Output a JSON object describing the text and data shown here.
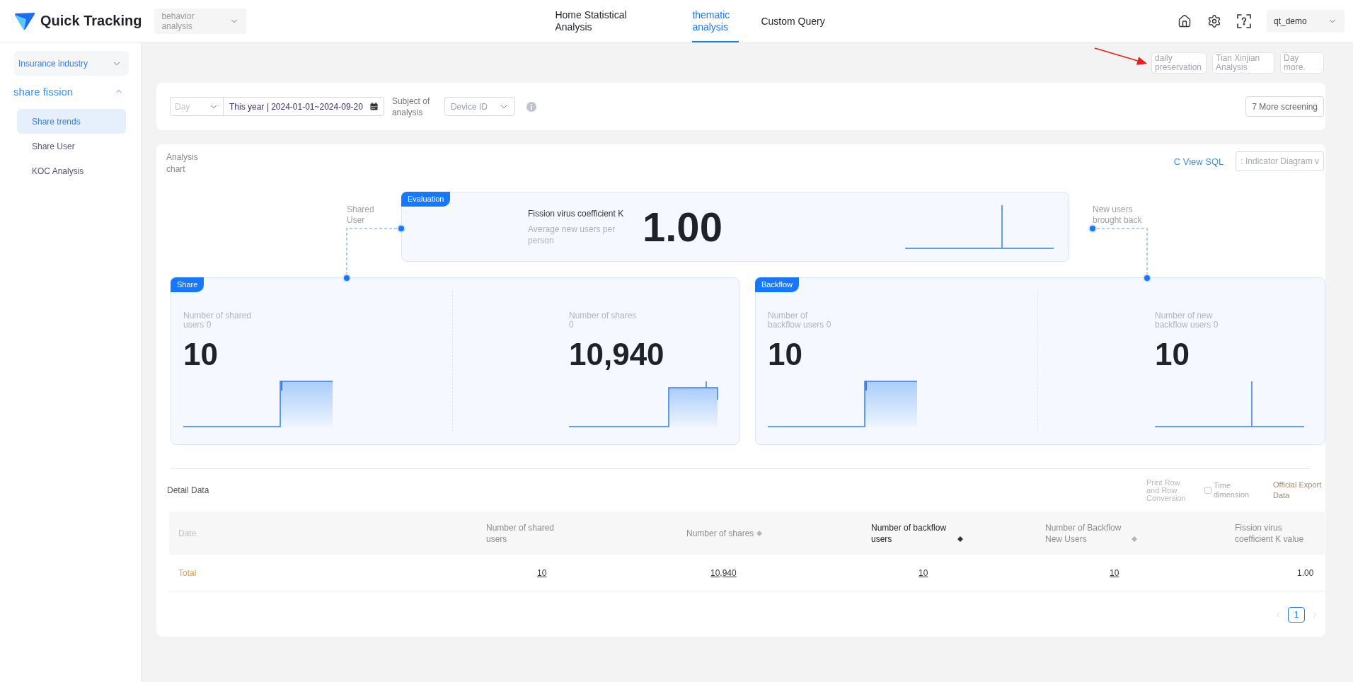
{
  "header": {
    "logo": "Quick Tracking",
    "module_select": "behavior analysis",
    "nav": [
      {
        "label": "Home Statistical Analysis",
        "selected": false
      },
      {
        "label": "thematic analysis",
        "selected": true
      },
      {
        "label": "Custom Query",
        "selected": false
      }
    ],
    "user_select": "qt_demo"
  },
  "sidebar": {
    "industry_select": "Insurance industry",
    "groups": [
      {
        "label": "share fission",
        "expanded": true,
        "children": [
          {
            "label": "Share trends",
            "selected": true
          },
          {
            "label": "Share User",
            "selected": false
          },
          {
            "label": "KOC Analysis",
            "selected": false
          }
        ]
      }
    ]
  },
  "quick_links": [
    "daily preservation",
    "Tian Xinjian Analysis",
    "Day more."
  ],
  "filters": {
    "granularity": {
      "placeholder": "Day"
    },
    "date_range": {
      "value": "This year | 2024-01-01~2024-09-20"
    },
    "subject_label": "Subject of analysis",
    "subject": {
      "placeholder": "Device ID"
    },
    "more_button": "7 More screening"
  },
  "analysis": {
    "title": "Analysis chart",
    "sql_link": "C View SQL",
    "view_select": ": Indicator Diagram v",
    "evaluation": {
      "tag": "Evaluation",
      "label": "Fission virus coefficient K",
      "subtitle": "Average new users per person",
      "value": "1.00"
    },
    "left_connector": "Shared User",
    "right_connector": "New users brought back",
    "groups": [
      {
        "tag": "Share",
        "metrics": [
          {
            "label": "Number of shared users 0",
            "value": "10",
            "kind": "step"
          },
          {
            "label": "Number of shares 0",
            "value": "10,940",
            "kind": "step-spike"
          }
        ]
      },
      {
        "tag": "Backflow",
        "metrics": [
          {
            "label": "Number of backflow users 0",
            "value": "10",
            "kind": "step"
          },
          {
            "label": "Number of new backflow users 0",
            "value": "10",
            "kind": "spike"
          }
        ]
      }
    ]
  },
  "detail": {
    "title": "Detail Data",
    "row_conversion": "Print Row and Row Conversion",
    "time_dimension": {
      "label": "Time dimension",
      "checked": false
    },
    "export": "Official Export Data",
    "columns": [
      {
        "label": "Date",
        "sortable": false,
        "sorted": false
      },
      {
        "label": "Number of shared users",
        "sortable": false,
        "sorted": false
      },
      {
        "label": "Number of shares",
        "sortable": true,
        "sorted": false
      },
      {
        "label": "Number of backflow users",
        "sortable": true,
        "sorted": true
      },
      {
        "label": "Number of Backflow New Users",
        "sortable": true,
        "sorted": false
      },
      {
        "label": "Fission virus coefficient K value",
        "sortable": false,
        "sorted": false
      }
    ],
    "rows": [
      {
        "kind": "total",
        "cells": [
          {
            "text": "Total",
            "link": false
          },
          {
            "text": "10",
            "link": true
          },
          {
            "text": "10,940",
            "link": true
          },
          {
            "text": "10",
            "link": true
          },
          {
            "text": "10",
            "link": true
          },
          {
            "text": "1.00",
            "link": false
          }
        ]
      }
    ],
    "pages": [
      {
        "label": "1",
        "selected": true
      }
    ]
  }
}
